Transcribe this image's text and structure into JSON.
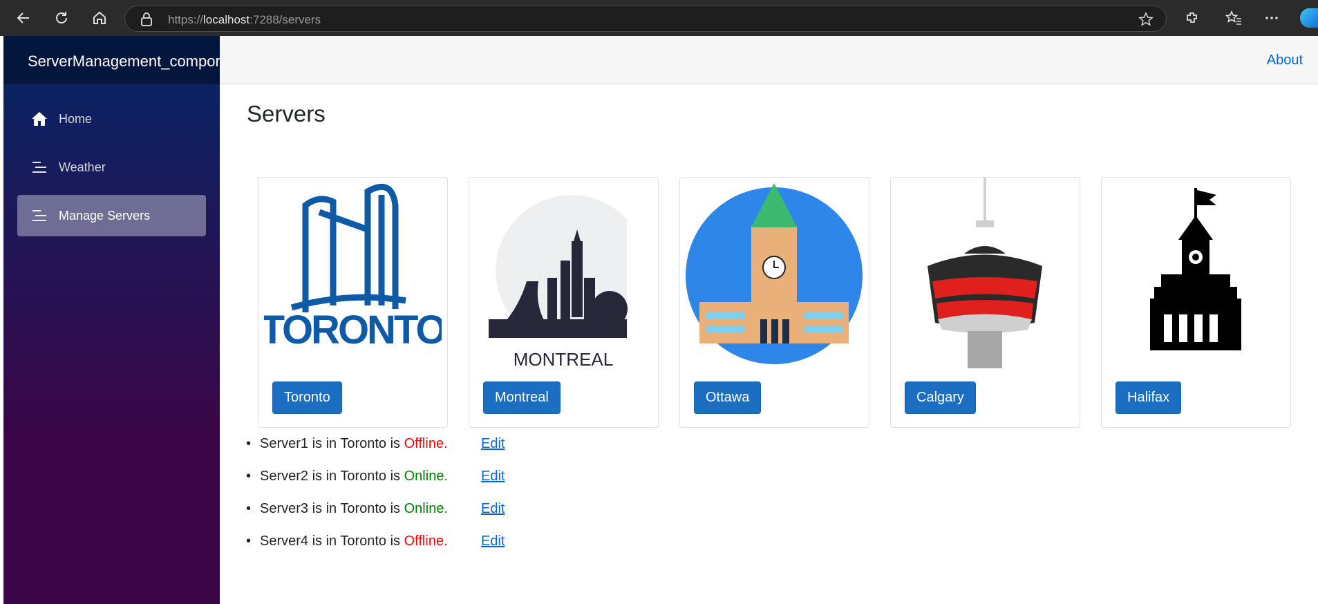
{
  "browser": {
    "url_scheme": "https://",
    "url_host": "localhost",
    "url_rest": ":7288/servers"
  },
  "sidebar": {
    "brand": "ServerManagement_compor",
    "items": [
      {
        "label": "Home",
        "icon": "home-icon"
      },
      {
        "label": "Weather",
        "icon": "list-icon"
      },
      {
        "label": "Manage Servers",
        "icon": "list-icon",
        "active": true
      }
    ]
  },
  "top_row": {
    "about_label": "About"
  },
  "main": {
    "title": "Servers",
    "cities": [
      {
        "name": "Toronto",
        "logo_text": "TORONTO"
      },
      {
        "name": "Montreal",
        "logo_text": "MONTREAL"
      },
      {
        "name": "Ottawa"
      },
      {
        "name": "Calgary"
      },
      {
        "name": "Halifax"
      }
    ],
    "servers": [
      {
        "prefix": "Server1 is in Toronto is ",
        "status": "Offline.",
        "edit": "Edit"
      },
      {
        "prefix": "Server2 is in Toronto is ",
        "status": "Online.",
        "edit": "Edit"
      },
      {
        "prefix": "Server3 is in Toronto is ",
        "status": "Online.",
        "edit": "Edit"
      },
      {
        "prefix": "Server4 is in Toronto is ",
        "status": "Offline.",
        "edit": "Edit"
      }
    ]
  },
  "colors": {
    "button": "#1b6ec2",
    "link": "#0366d6",
    "offline": "#ff0000",
    "online": "#008000"
  }
}
